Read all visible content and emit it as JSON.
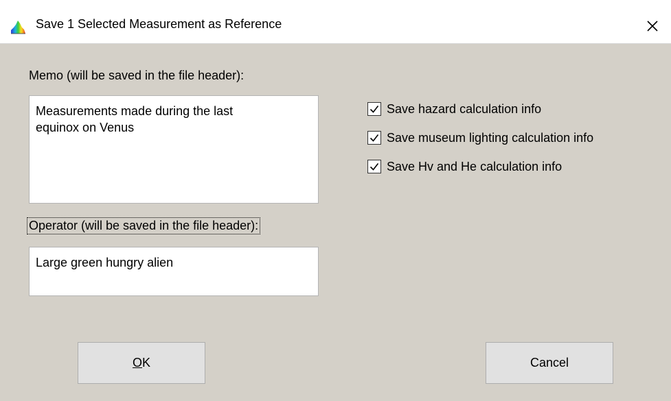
{
  "window": {
    "title": "Save 1 Selected Measurement as Reference",
    "app_icon": "spectrum-icon",
    "close_icon": "close-icon"
  },
  "memo": {
    "label": "Memo (will be saved in the file header):",
    "value": "Measurements made during the last\nequinox on Venus"
  },
  "operator": {
    "label": "Operator (will be saved in the file header):",
    "value": "Large green hungry alien"
  },
  "options": [
    {
      "label": "Save hazard calculation info",
      "checked": true
    },
    {
      "label": "Save museum lighting calculation info",
      "checked": true
    },
    {
      "label": "Save Hv and He calculation info",
      "checked": true
    }
  ],
  "buttons": {
    "ok_mnemonic": "O",
    "ok_rest": "K",
    "cancel": "Cancel"
  },
  "colors": {
    "dialog_background": "#d4d0c8",
    "titlebar_background": "#ffffff",
    "button_face": "#e1e1e1"
  }
}
